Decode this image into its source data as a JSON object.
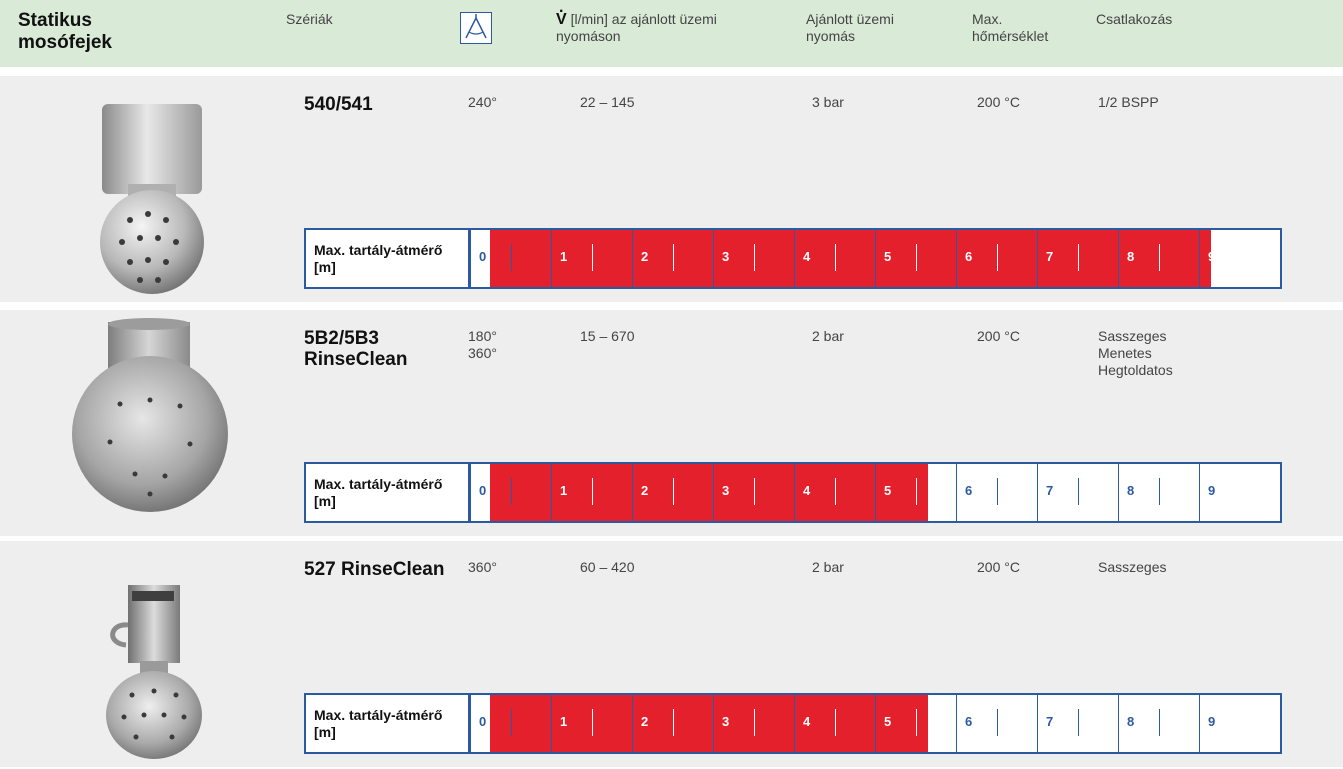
{
  "header": {
    "title": "Statikus mosófejek",
    "col_series": "Szériák",
    "col_flow_symbol": "V",
    "col_flow_text": "[l/min] az ajánlott üzemi nyomáson",
    "col_pressure": "Ajánlott üzemi nyomás",
    "col_temp": "Max. hőmérséklet",
    "col_connection": "Csatlakozás"
  },
  "scale_label": "Max. tartály-átmérő [m]",
  "scale_numbers": [
    "0",
    "1",
    "2",
    "3",
    "4",
    "5",
    "6",
    "7",
    "8",
    "9"
  ],
  "products": [
    {
      "model": "540/541",
      "angle": "240°",
      "flow": "22 – 145",
      "pressure": "3 bar",
      "temp": "200 °C",
      "connection": "1/2 BSPP",
      "max_diameter_m": 9
    },
    {
      "model": "5B2/5B3 RinseClean",
      "angle": "180°\n360°",
      "flow": "15 – 670",
      "pressure": "2 bar",
      "temp": "200 °C",
      "connection": "Sasszeges\nMenetes\nHegtoldatos",
      "max_diameter_m": 5.5
    },
    {
      "model": "527 RinseClean",
      "angle": "360°",
      "flow": "60 – 420",
      "pressure": "2 bar",
      "temp": "200 °C",
      "connection": "Sasszeges",
      "max_diameter_m": 5.5
    }
  ],
  "colors": {
    "header_bg": "#d9ead7",
    "section_bg": "#eeeeee",
    "bar_fill": "#e3202b",
    "scale_border": "#2b5aa0"
  }
}
